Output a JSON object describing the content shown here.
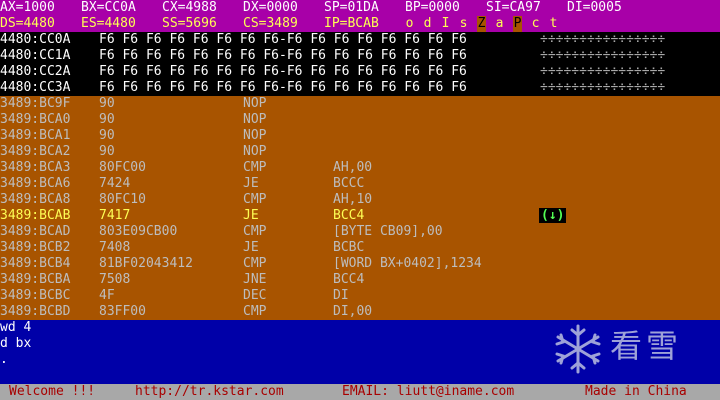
{
  "registers": {
    "row1": [
      "AX=1000",
      "BX=CC0A",
      "CX=4988",
      "DX=0000",
      "SP=01DA",
      "BP=0000",
      "SI=CA97",
      "DI=0005"
    ],
    "row2": [
      "DS=4480",
      "ES=4480",
      "SS=5696",
      "CS=3489",
      "IP=BCAB"
    ],
    "flags": [
      {
        "label": "o",
        "set": false
      },
      {
        "label": "d",
        "set": false
      },
      {
        "label": "I",
        "set": false
      },
      {
        "label": "s",
        "set": false
      },
      {
        "label": "Z",
        "set": true
      },
      {
        "label": "a",
        "set": false
      },
      {
        "label": "P",
        "set": true
      },
      {
        "label": "c",
        "set": false
      },
      {
        "label": "t",
        "set": false
      }
    ]
  },
  "dump": [
    {
      "addr": "4480:CC0A",
      "bytes": "F6 F6 F6 F6 F6 F6 F6 F6-F6 F6 F6 F6 F6 F6 F6 F6",
      "ascii": "÷÷÷÷÷÷÷÷÷÷÷÷÷÷÷÷"
    },
    {
      "addr": "4480:CC1A",
      "bytes": "F6 F6 F6 F6 F6 F6 F6 F6-F6 F6 F6 F6 F6 F6 F6 F6",
      "ascii": "÷÷÷÷÷÷÷÷÷÷÷÷÷÷÷÷"
    },
    {
      "addr": "4480:CC2A",
      "bytes": "F6 F6 F6 F6 F6 F6 F6 F6-F6 F6 F6 F6 F6 F6 F6 F6",
      "ascii": "÷÷÷÷÷÷÷÷÷÷÷÷÷÷÷÷"
    },
    {
      "addr": "4480:CC3A",
      "bytes": "F6 F6 F6 F6 F6 F6 F6 F6-F6 F6 F6 F6 F6 F6 F6 F6",
      "ascii": "÷÷÷÷÷÷÷÷÷÷÷÷÷÷÷÷"
    }
  ],
  "disasm": [
    {
      "addr": "3489:BC9F",
      "hex": "90",
      "mnem": "NOP",
      "ops": "",
      "current": false
    },
    {
      "addr": "3489:BCA0",
      "hex": "90",
      "mnem": "NOP",
      "ops": "",
      "current": false
    },
    {
      "addr": "3489:BCA1",
      "hex": "90",
      "mnem": "NOP",
      "ops": "",
      "current": false
    },
    {
      "addr": "3489:BCA2",
      "hex": "90",
      "mnem": "NOP",
      "ops": "",
      "current": false
    },
    {
      "addr": "3489:BCA3",
      "hex": "80FC00",
      "mnem": "CMP",
      "ops": "AH,00",
      "current": false
    },
    {
      "addr": "3489:BCA6",
      "hex": "7424",
      "mnem": "JE",
      "ops": "BCCC",
      "current": false
    },
    {
      "addr": "3489:BCA8",
      "hex": "80FC10",
      "mnem": "CMP",
      "ops": "AH,10",
      "current": false
    },
    {
      "addr": "3489:BCAB",
      "hex": "7417",
      "mnem": "JE",
      "ops": "BCC4",
      "current": true,
      "jump": "(↓)"
    },
    {
      "addr": "3489:BCAD",
      "hex": "803E09CB00",
      "mnem": "CMP",
      "ops": "[BYTE CB09],00",
      "current": false
    },
    {
      "addr": "3489:BCB2",
      "hex": "7408",
      "mnem": "JE",
      "ops": "BCBC",
      "current": false
    },
    {
      "addr": "3489:BCB4",
      "hex": "81BF02043412",
      "mnem": "CMP",
      "ops": "[WORD BX+0402],1234",
      "current": false
    },
    {
      "addr": "3489:BCBA",
      "hex": "7508",
      "mnem": "JNE",
      "ops": "BCC4",
      "current": false
    },
    {
      "addr": "3489:BCBC",
      "hex": "4F",
      "mnem": "DEC",
      "ops": "DI",
      "current": false
    },
    {
      "addr": "3489:BCBD",
      "hex": "83FF00",
      "mnem": "CMP",
      "ops": "DI,00",
      "current": false
    }
  ],
  "command": {
    "lines": [
      "wd 4",
      "d bx",
      "."
    ]
  },
  "logo": {
    "text": "看雪",
    "icon": "snowflake-icon"
  },
  "status_bar": {
    "welcome": "Welcome !!!",
    "url": "http://tr.kstar.com",
    "email": "EMAIL: liutt@iname.com",
    "made_in": "Made in China"
  },
  "colors": {
    "registers_bg": "#a800a8",
    "dump_bg": "#000000",
    "disasm_bg": "#a85400",
    "command_bg": "#0000a8",
    "status_bg": "#a8a8a8",
    "current_line": "#fefe54",
    "jump_indicator": "#54fe54"
  }
}
